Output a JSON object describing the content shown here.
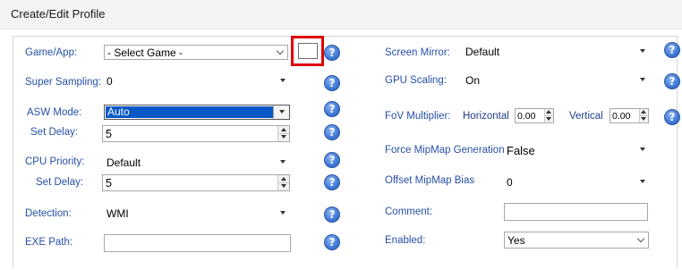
{
  "window": {
    "title": "Create/Edit Profile"
  },
  "left": {
    "game_app": {
      "label": "Game/App:",
      "value": "- Select Game -"
    },
    "super_sampling": {
      "label": "Super Sampling:",
      "value": "0"
    },
    "asw_mode": {
      "label": "ASW Mode:",
      "value": "Auto"
    },
    "asw_set_delay": {
      "label": "Set Delay:",
      "value": "5"
    },
    "cpu_priority": {
      "label": "CPU Priority:",
      "value": "Default"
    },
    "cpu_set_delay": {
      "label": "Set Delay:",
      "value": "5"
    },
    "detection": {
      "label": "Detection:",
      "value": "WMI"
    },
    "exe_path": {
      "label": "EXE Path:",
      "value": ""
    }
  },
  "right": {
    "screen_mirror": {
      "label": "Screen Mirror:",
      "value": "Default"
    },
    "gpu_scaling": {
      "label": "GPU Scaling:",
      "value": "On"
    },
    "fov_multiplier": {
      "label": "FoV Multiplier:",
      "horizontal_label": "Horizontal",
      "horizontal_value": "0.00",
      "vertical_label": "Vertical",
      "vertical_value": "0.00"
    },
    "force_mipmap": {
      "label": "Force MipMap Generation",
      "value": "False"
    },
    "offset_mipmap": {
      "label": "Offset MipMap Bias",
      "value": "0"
    },
    "comment": {
      "label": "Comment:",
      "value": ""
    },
    "enabled": {
      "label": "Enabled:",
      "value": "Yes"
    }
  },
  "help_icon_glyph": "?",
  "colors": {
    "label": "#2650a8",
    "selection": "#0a58c8",
    "highlight_border": "#e00000",
    "help_icon": "#3f78d6"
  }
}
